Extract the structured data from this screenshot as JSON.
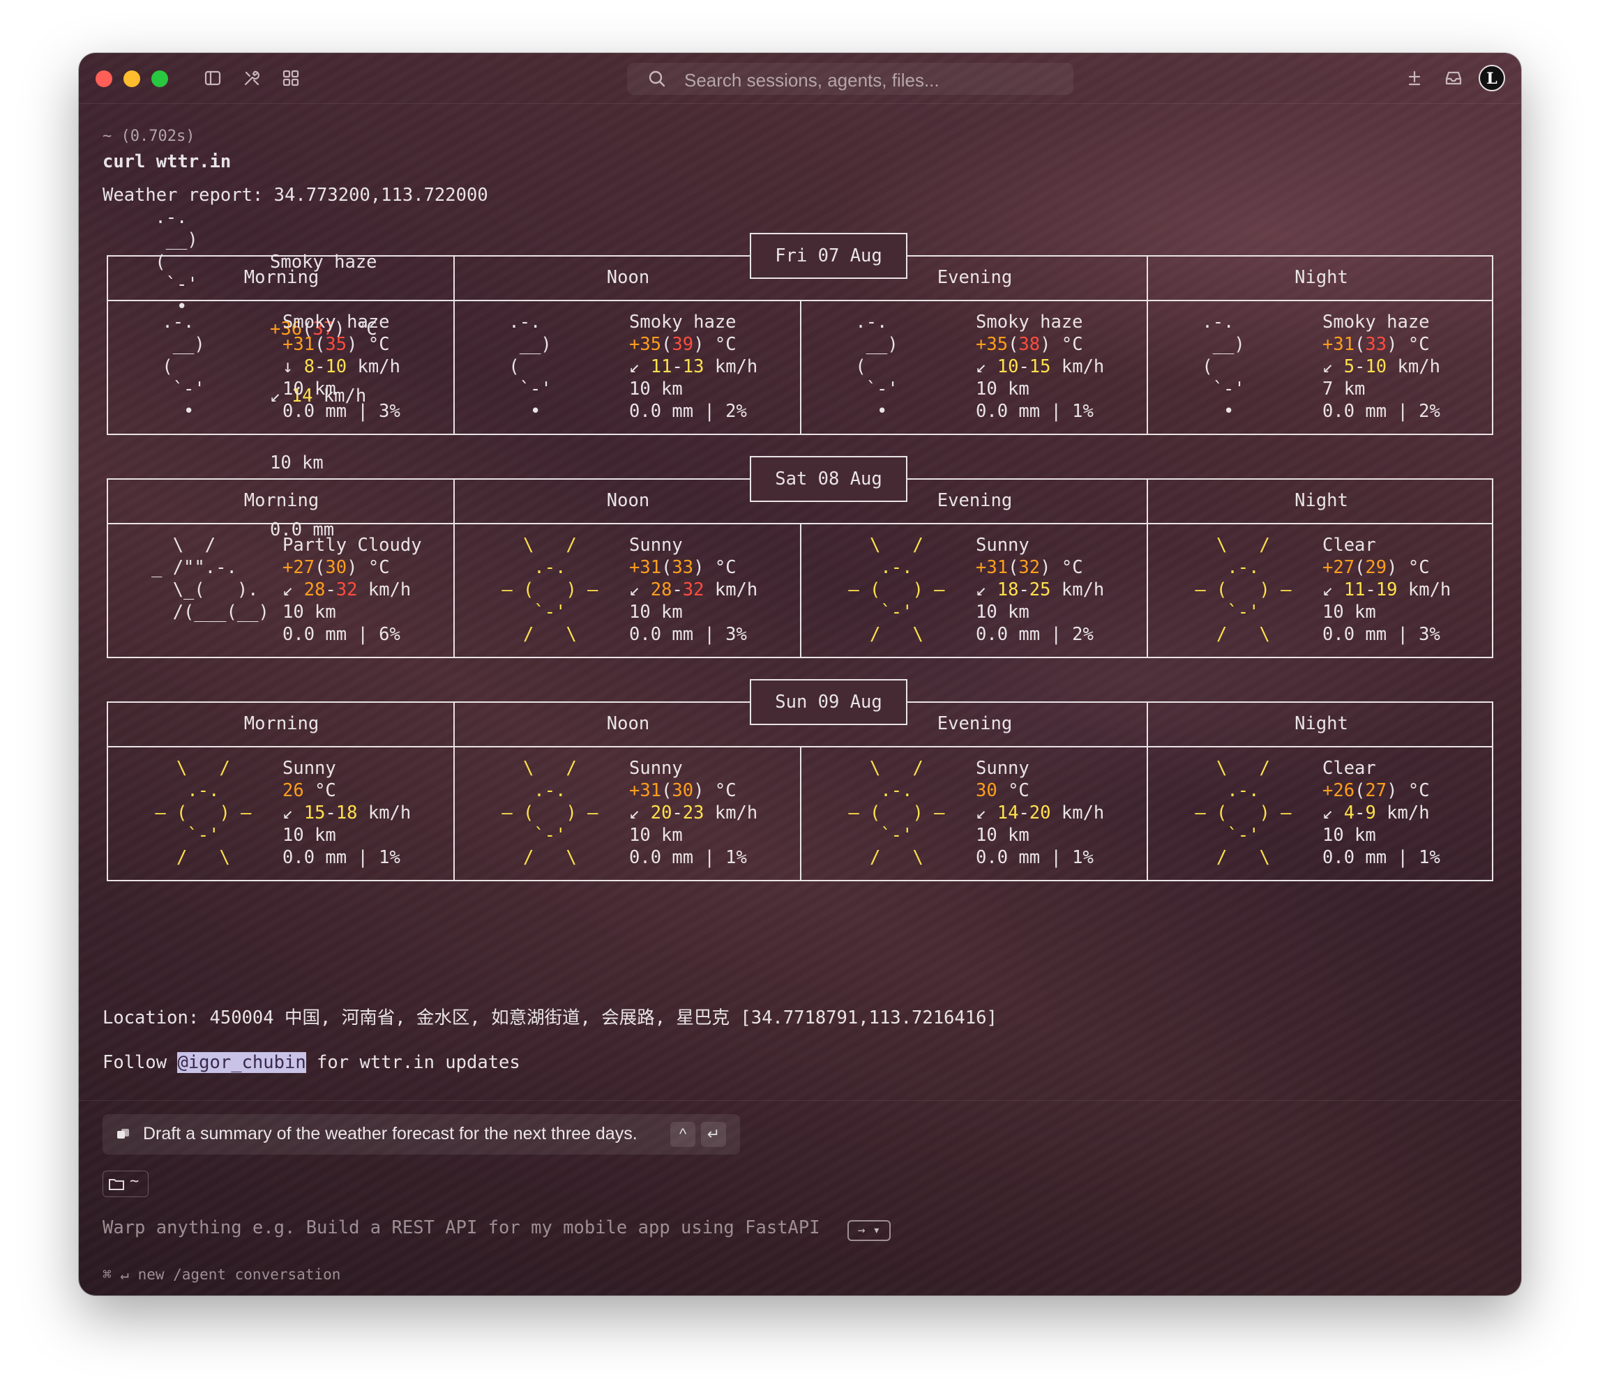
{
  "window": {
    "search_placeholder": "Search sessions, agents, files...",
    "avatar_letter": "L",
    "icons": [
      "sidebar-icon",
      "tools-icon",
      "grid-icon",
      "search-icon",
      "add-session-icon",
      "inbox-icon"
    ]
  },
  "terminal": {
    "timing": "~ (0.702s)",
    "command": "curl wttr.in",
    "report_prefix": "Weather report: ",
    "report_coords": "34.773200,113.722000",
    "current": {
      "art": [
        " .-.",
        "  __)",
        " (",
        "  `-'",
        "   •"
      ],
      "condition": "Smoky haze",
      "temp": {
        "main": "+36",
        "feels": "37",
        "unit": " °C"
      },
      "wind": {
        "arrow": "↙",
        "speed": "14",
        "unit": " km/h"
      },
      "visibility": "10 km",
      "precip": "0.0 mm"
    },
    "periods": [
      "Morning",
      "Noon",
      "Evening",
      "Night"
    ],
    "days": [
      {
        "date": "Fri 07 Aug",
        "cells": [
          {
            "art": [
              " .-.",
              "  __)",
              " (",
              "  `-'",
              "   •"
            ],
            "condition": "Smoky haze",
            "temp": "+31",
            "feels": "35",
            "wind_arrow": "↓",
            "wind_lo": "8",
            "wind_hi": "10",
            "vis": "10 km",
            "precip": "0.0 mm | 3%"
          },
          {
            "art": [
              " .-.",
              "  __)",
              " (",
              "  `-'",
              "   •"
            ],
            "condition": "Smoky haze",
            "temp": "+35",
            "feels": "39",
            "wind_arrow": "↙",
            "wind_lo": "11",
            "wind_hi": "13",
            "vis": "10 km",
            "precip": "0.0 mm | 2%"
          },
          {
            "art": [
              " .-.",
              "  __)",
              " (",
              "  `-'",
              "   •"
            ],
            "condition": "Smoky haze",
            "temp": "+35",
            "feels": "38",
            "wind_arrow": "↙",
            "wind_lo": "10",
            "wind_hi": "15",
            "vis": "10 km",
            "precip": "0.0 mm | 1%"
          },
          {
            "art": [
              " .-.",
              "  __)",
              " (",
              "  `-'",
              "   •"
            ],
            "condition": "Smoky haze",
            "temp": "+31",
            "feels": "33",
            "wind_arrow": "↙",
            "wind_lo": "5",
            "wind_hi": "10",
            "vis": "7 km",
            "precip": "0.0 mm | 2%"
          }
        ]
      },
      {
        "date": "Sat 08 Aug",
        "cells": [
          {
            "art": [
              "  \\  /",
              "_ /\"\".-.",
              "  \\_(   ).",
              "  /(___(__)",
              ""
            ],
            "art_color": "mixed",
            "condition": "Partly Cloudy",
            "temp": "+27",
            "feels": "30",
            "wind_arrow": "↙",
            "wind_lo": "28",
            "wind_hi": "32",
            "vis": "10 km",
            "precip": "0.0 mm | 6%"
          },
          {
            "art": [
              "   \\   /",
              "    .-.",
              " ‒ (   ) ‒",
              "    `-'",
              "   /   \\"
            ],
            "art_color": "sun",
            "condition": "Sunny",
            "temp": "+31",
            "feels": "33",
            "wind_arrow": "↙",
            "wind_lo": "28",
            "wind_hi": "32",
            "vis": "10 km",
            "precip": "0.0 mm | 3%"
          },
          {
            "art": [
              "   \\   /",
              "    .-.",
              " ‒ (   ) ‒",
              "    `-'",
              "   /   \\"
            ],
            "art_color": "sun",
            "condition": "Sunny",
            "temp": "+31",
            "feels": "32",
            "wind_arrow": "↙",
            "wind_lo": "18",
            "wind_hi": "25",
            "vis": "10 km",
            "precip": "0.0 mm | 2%"
          },
          {
            "art": [
              "   \\   /",
              "    .-.",
              " ‒ (   ) ‒",
              "    `-'",
              "   /   \\"
            ],
            "art_color": "sun",
            "condition": "Clear",
            "temp": "+27",
            "feels": "29",
            "wind_arrow": "↙",
            "wind_lo": "11",
            "wind_hi": "19",
            "vis": "10 km",
            "precip": "0.0 mm | 3%"
          }
        ]
      },
      {
        "date": "Sun 09 Aug",
        "cells": [
          {
            "art": [
              "   \\   /",
              "    .-.",
              " ‒ (   ) ‒",
              "    `-'",
              "   /   \\"
            ],
            "art_color": "sun",
            "condition": "Sunny",
            "temp": "26",
            "feels": "",
            "wind_arrow": "↙",
            "wind_lo": "15",
            "wind_hi": "18",
            "vis": "10 km",
            "precip": "0.0 mm | 1%"
          },
          {
            "art": [
              "   \\   /",
              "    .-.",
              " ‒ (   ) ‒",
              "    `-'",
              "   /   \\"
            ],
            "art_color": "sun",
            "condition": "Sunny",
            "temp": "+31",
            "feels": "30",
            "wind_arrow": "↙",
            "wind_lo": "20",
            "wind_hi": "23",
            "vis": "10 km",
            "precip": "0.0 mm | 1%"
          },
          {
            "art": [
              "   \\   /",
              "    .-.",
              " ‒ (   ) ‒",
              "    `-'",
              "   /   \\"
            ],
            "art_color": "sun",
            "condition": "Sunny",
            "temp": "30",
            "feels": "",
            "wind_arrow": "↙",
            "wind_lo": "14",
            "wind_hi": "20",
            "vis": "10 km",
            "precip": "0.0 mm | 1%"
          },
          {
            "art": [
              "   \\   /",
              "    .-.",
              " ‒ (   ) ‒",
              "    `-'",
              "   /   \\"
            ],
            "art_color": "sun",
            "condition": "Clear",
            "temp": "+26",
            "feels": "27",
            "wind_arrow": "↙",
            "wind_lo": "4",
            "wind_hi": "9",
            "vis": "10 km",
            "precip": "0.0 mm | 1%"
          }
        ]
      }
    ],
    "location": "Location: 450004 中国, 河南省, 金水区, 如意湖街道, 会展路, 星巴克 [34.7718791,113.7216416]",
    "follow_prefix": "Follow ",
    "follow_handle": "@igor_chubin",
    "follow_suffix": " for wttr.in updates"
  },
  "input": {
    "suggestion": "Draft a summary of the weather forecast for the next three days.",
    "suggestion_key_up": "^",
    "suggestion_key_enter": "↵",
    "folder_label": "~",
    "prompt_placeholder": "Warp anything e.g. Build a REST API for my mobile app using FastAPI",
    "mode_badge": "→ ▾",
    "hint": "⌘ ↵ new /agent conversation"
  }
}
